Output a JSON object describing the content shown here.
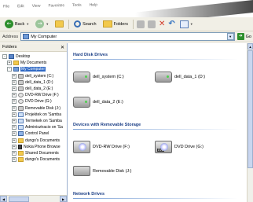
{
  "menubar": {
    "items": [
      "File",
      "Edit",
      "View",
      "Favorites",
      "Tools",
      "Help"
    ]
  },
  "toolbar": {
    "back_label": "Back",
    "search_label": "Search",
    "folders_label": "Folders"
  },
  "address": {
    "label": "Address",
    "value": "My Computer",
    "go_label": "Go"
  },
  "folders_pane": {
    "title": "Folders",
    "tree": [
      {
        "label": "Desktop",
        "icon": "desktop-icon",
        "expander": "-",
        "indent": 0
      },
      {
        "label": "My Documents",
        "icon": "folder-icon",
        "expander": "+",
        "indent": 1
      },
      {
        "label": "My Computer",
        "icon": "computer-icon",
        "expander": "-",
        "indent": 1,
        "selected": true
      },
      {
        "label": "dell_system (C:)",
        "icon": "drive-icon",
        "expander": "+",
        "indent": 2
      },
      {
        "label": "dell_data_1 (D:)",
        "icon": "drive-icon",
        "expander": "+",
        "indent": 2
      },
      {
        "label": "dell_data_2 (E:)",
        "icon": "drive-icon",
        "expander": "+",
        "indent": 2
      },
      {
        "label": "DVD-RW Drive (F:)",
        "icon": "cd-icon",
        "expander": "+",
        "indent": 2
      },
      {
        "label": "DVD Drive (G:)",
        "icon": "cd-icon",
        "expander": "+",
        "indent": 2
      },
      {
        "label": "Removable Disk (J:)",
        "icon": "drive-icon",
        "expander": "+",
        "indent": 2
      },
      {
        "label": "Projektek on 'Samba",
        "icon": "network-drive-icon",
        "expander": "+",
        "indent": 2
      },
      {
        "label": "Termekek on 'Samba",
        "icon": "network-drive-icon",
        "expander": "+",
        "indent": 2
      },
      {
        "label": "Adminisztracio on 'Sa",
        "icon": "network-drive-icon",
        "expander": "+",
        "indent": 2
      },
      {
        "label": "Control Panel",
        "icon": "control-panel-icon",
        "expander": "+",
        "indent": 2
      },
      {
        "label": "dungo's Documents",
        "icon": "folder-icon",
        "expander": "+",
        "indent": 2
      },
      {
        "label": "Nokia Phone Browse",
        "icon": "phone-icon",
        "expander": "+",
        "indent": 2
      },
      {
        "label": "Shared Documents",
        "icon": "folder-icon",
        "expander": "+",
        "indent": 2
      },
      {
        "label": "dungo's Documents",
        "icon": "folder-icon",
        "expander": "+",
        "indent": 2
      }
    ]
  },
  "main": {
    "sections": {
      "hdd_title": "Hard Disk Drives",
      "removable_title": "Devices with Removable Storage",
      "network_title": "Network Drives"
    },
    "hdd_items": [
      "dell_system (C:)",
      "dell_data_1 (D:)",
      "dell_data_2 (E:)"
    ],
    "removable_items": [
      "DVD-RW Drive (F:)",
      "DVD Drive (G:)",
      "Removable Disk (J:)"
    ]
  }
}
